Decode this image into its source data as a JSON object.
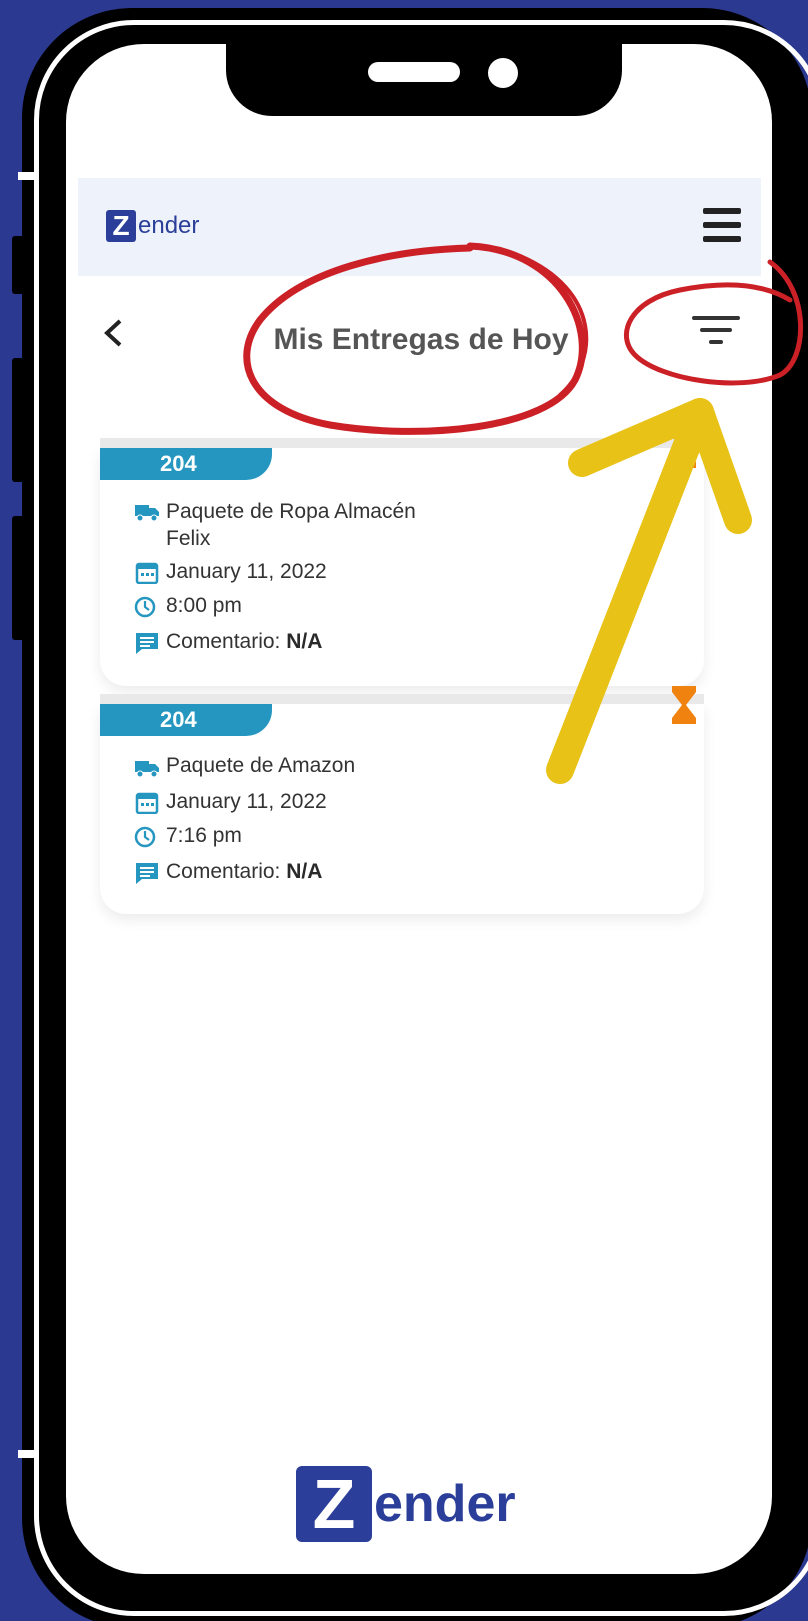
{
  "app": {
    "brand_small": "ender",
    "brand_big": "ender",
    "brand_letter": "Z"
  },
  "header": {
    "title": "Mis Entregas de Hoy"
  },
  "deliveries": [
    {
      "id": "204",
      "package": "Paquete de Ropa Almacén Felix",
      "date": "January 11, 2022",
      "time": "8:00 pm",
      "comment_label": "Comentario:",
      "comment_value": "N/A"
    },
    {
      "id": "204",
      "package": "Paquete de Amazon",
      "date": "January 11, 2022",
      "time": "7:16 pm",
      "comment_label": "Comentario:",
      "comment_value": "N/A"
    }
  ],
  "colors": {
    "background": "#2b3990",
    "brand": "#2b3f9a",
    "badge": "#2496c0",
    "status": "#f0820f",
    "annotation_red": "#cc2027",
    "annotation_yellow": "#e8c216"
  },
  "icons": [
    "menu-icon",
    "back-icon",
    "filter-icon",
    "truck-icon",
    "calendar-icon",
    "clock-icon",
    "comment-icon",
    "hourglass-icon"
  ]
}
